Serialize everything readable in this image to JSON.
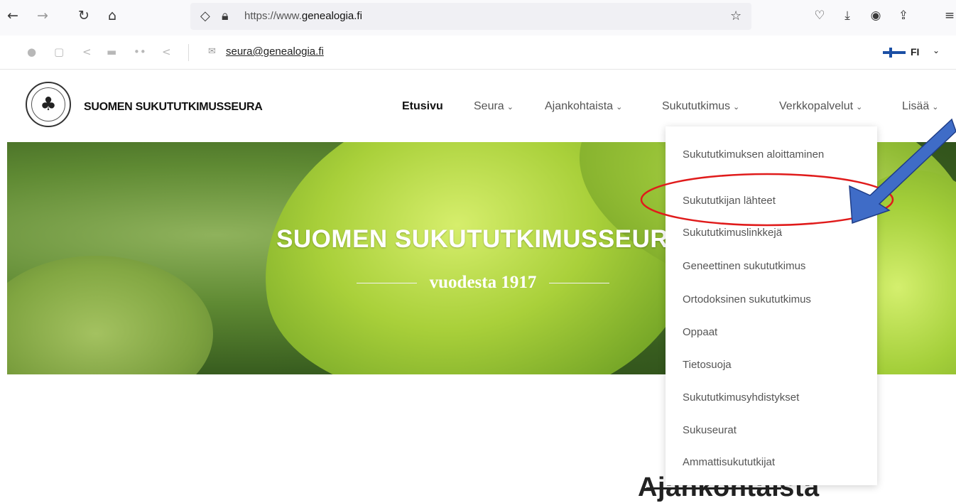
{
  "browser": {
    "url_prefix": "https://www.",
    "url_domain": "genealogia.fi",
    "icons": [
      "back-icon",
      "forward-icon",
      "reload-icon",
      "home-icon",
      "shield-icon",
      "lock-icon",
      "star-icon",
      "pocket-icon",
      "download-icon",
      "account-icon",
      "share-icon",
      "menu-icon"
    ]
  },
  "topbar": {
    "social_icons": [
      "facebook-icon",
      "instagram-icon",
      "share-icon",
      "youtube-icon",
      "flickr-icon",
      "share-icon"
    ],
    "email": "seura@genealogia.fi",
    "language": "FI"
  },
  "header": {
    "site_name": "SUOMEN SUKUTUTKIMUSSEURA",
    "menu": [
      {
        "label": "Etusivu",
        "active": true
      },
      {
        "label": "Seura"
      },
      {
        "label": "Ajankohtaista"
      },
      {
        "label": "Sukututkimus"
      },
      {
        "label": "Verkkopalvelut"
      },
      {
        "label": "Lisää"
      }
    ]
  },
  "hero": {
    "title": "SUOMEN SUKUTUTKIMUSSEURA",
    "subtitle": "vuodesta 1917"
  },
  "dropdown": {
    "items": [
      "Sukututkimuksen aloittaminen",
      "Sukututkijan lähteet",
      "Sukututkimuslinkkejä",
      "Geneettinen sukututkimus",
      "Ortodoksinen sukututkimus",
      "Oppaat",
      "Tietosuoja",
      "Sukututkimusyhdistykset",
      "Sukuseurat",
      "Ammattisukututkijat"
    ]
  },
  "section": {
    "heading": "Ajankohtaista"
  },
  "colors": {
    "annotation_ellipse": "#e01b1b",
    "annotation_arrow": "#3f6cc7",
    "flag_blue": "#1b4fa5"
  }
}
